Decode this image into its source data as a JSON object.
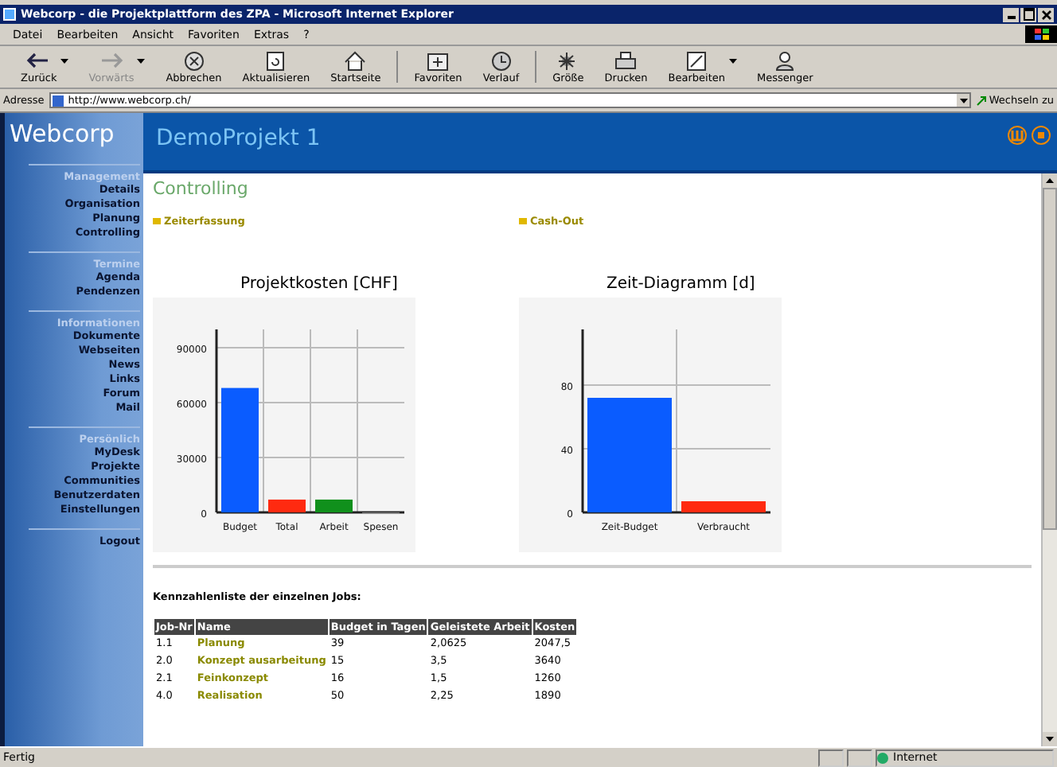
{
  "window": {
    "title": "Webcorp - die Projektplattform des ZPA - Microsoft Internet Explorer"
  },
  "menu": [
    "Datei",
    "Bearbeiten",
    "Ansicht",
    "Favoriten",
    "Extras",
    "?"
  ],
  "toolbar": [
    {
      "label": "Zurück",
      "kind": "back",
      "disabled": false,
      "dropdown": true
    },
    {
      "label": "Vorwärts",
      "kind": "forward",
      "disabled": true,
      "dropdown": true
    },
    {
      "label": "Abbrechen",
      "kind": "stop",
      "disabled": false,
      "dropdown": false
    },
    {
      "label": "Aktualisieren",
      "kind": "refresh",
      "disabled": false,
      "dropdown": false
    },
    {
      "label": "Startseite",
      "kind": "home",
      "disabled": false,
      "dropdown": false
    },
    {
      "label": "Favoriten",
      "kind": "favorites",
      "disabled": false,
      "dropdown": false
    },
    {
      "label": "Verlauf",
      "kind": "history",
      "disabled": false,
      "dropdown": false
    },
    {
      "label": "Größe",
      "kind": "size",
      "disabled": false,
      "dropdown": false
    },
    {
      "label": "Drucken",
      "kind": "print",
      "disabled": false,
      "dropdown": false
    },
    {
      "label": "Bearbeiten",
      "kind": "edit",
      "disabled": false,
      "dropdown": true
    },
    {
      "label": "Messenger",
      "kind": "messenger",
      "disabled": false,
      "dropdown": false
    }
  ],
  "address": {
    "label": "Adresse",
    "value": "http://www.webcorp.ch/",
    "go": "Wechseln zu"
  },
  "sidebar": {
    "logo": "Webcorp",
    "sections": [
      {
        "heading": "Management",
        "items": [
          "Details",
          "Organisation",
          "Planung",
          "Controlling"
        ]
      },
      {
        "heading": "Termine",
        "items": [
          "Agenda",
          "Pendenzen"
        ]
      },
      {
        "heading": "Informationen",
        "items": [
          "Dokumente",
          "Webseiten",
          "News",
          "Links",
          "Forum",
          "Mail"
        ]
      },
      {
        "heading": "Persönlich",
        "items": [
          "MyDesk",
          "Projekte",
          "Communities",
          "Benutzerdaten",
          "Einstellungen"
        ]
      }
    ],
    "logout": "Logout"
  },
  "project_title": "DemoProjekt 1",
  "page_title": "Controlling",
  "links": [
    "Zeiterfassung",
    "Cash-Out"
  ],
  "charts": [
    {
      "chart_data": {
        "type": "bar",
        "title": "Projektkosten [CHF]",
        "grid": true,
        "stacked": true,
        "ylim": [
          0,
          100000
        ],
        "yticks": [
          0,
          30000,
          60000,
          90000
        ],
        "series": [
          {
            "name": "Budget",
            "color": "#0a5cff",
            "values": [
              68000,
              null,
              null,
              null
            ]
          },
          {
            "name": "Total",
            "color": "#ff2a10",
            "values": [
              null,
              7000,
              null,
              null
            ]
          },
          {
            "name": "Arbeit",
            "color": "#10901c",
            "values": [
              null,
              null,
              7000,
              null
            ]
          },
          {
            "name": "Spesen",
            "color": "#808080",
            "values": [
              null,
              null,
              null,
              0
            ]
          }
        ]
      }
    },
    {
      "chart_data": {
        "type": "bar",
        "title": "Zeit-Diagramm [d]",
        "grid": true,
        "stacked": true,
        "ylim": [
          0,
          115
        ],
        "yticks": [
          0,
          40,
          80
        ],
        "series": [
          {
            "name": "Zeit-Budget",
            "color": "#0a5cff",
            "values": [
              72,
              null
            ]
          },
          {
            "name": "Verbraucht",
            "color": "#ff2a10",
            "values": [
              null,
              7
            ]
          }
        ]
      }
    }
  ],
  "jobs": {
    "heading": "Kennzahlenliste der einzelnen Jobs:",
    "columns": [
      "Job-Nr",
      "Name",
      "Budget in Tagen",
      "Geleistete Arbeit",
      "Kosten"
    ],
    "rows": [
      [
        "1.1",
        "Planung",
        "39",
        "2,0625",
        "2047,5"
      ],
      [
        "2.0",
        "Konzept ausarbeitung",
        "15",
        "3,5",
        "3640"
      ],
      [
        "2.1",
        "Feinkonzept",
        "16",
        "1,5",
        "1260"
      ],
      [
        "4.0",
        "Realisation",
        "50",
        "2,25",
        "1890"
      ]
    ]
  },
  "status_bar": {
    "text": "Fertig",
    "zone": "Internet"
  }
}
